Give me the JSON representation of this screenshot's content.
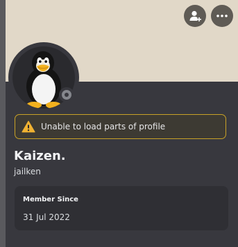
{
  "profile": {
    "display_name": "Kaizen.",
    "username": "jailken",
    "status": "offline"
  },
  "banner": {
    "color": "#e1d8c8",
    "buttons": [
      {
        "name": "add-friend",
        "icon": "add-friend-icon"
      },
      {
        "name": "more-options",
        "icon": "more-options-icon"
      }
    ]
  },
  "avatar": {
    "icon": "tux-penguin-icon"
  },
  "warning": {
    "icon": "warning-icon",
    "text": "Unable to load parts of profile",
    "accent_color": "#c9a227"
  },
  "member_since": {
    "label": "Member Since",
    "date": "31 Jul 2022"
  }
}
